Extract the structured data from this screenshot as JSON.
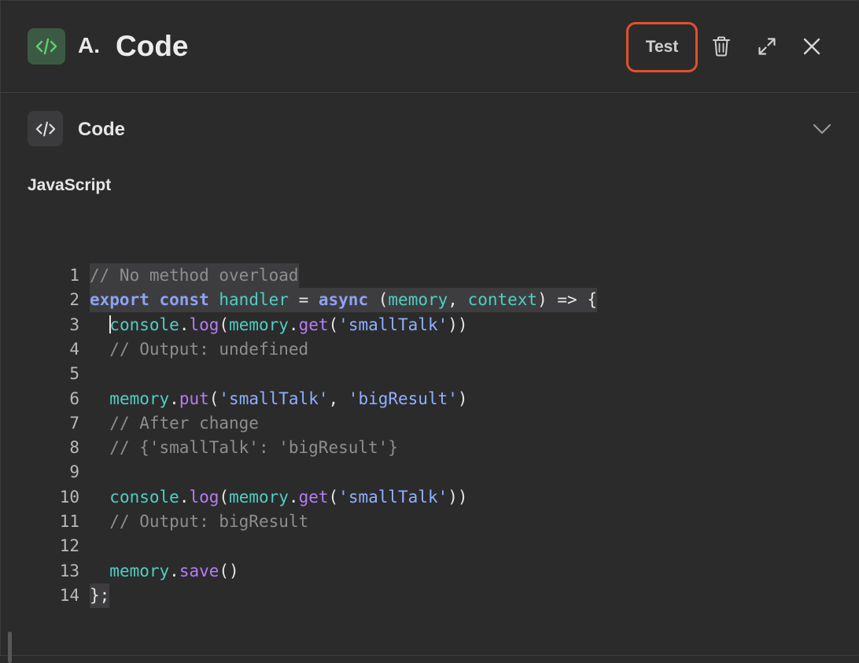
{
  "header": {
    "icon": "code-icon",
    "prefix": "A.",
    "title": "Code",
    "test_label": "Test",
    "buttons": [
      "trash-icon",
      "expand-icon",
      "close-icon"
    ],
    "accent_color": "#e2502b"
  },
  "section": {
    "icon": "code-icon",
    "title": "Code",
    "toggle_icon": "chevron-down-icon"
  },
  "editor": {
    "language_label": "JavaScript",
    "lines": [
      {
        "num": "1",
        "text": "// No method overload"
      },
      {
        "num": "2",
        "text": "export const handler = async (memory, context) => {"
      },
      {
        "num": "3",
        "text": "  console.log(memory.get('smallTalk'))"
      },
      {
        "num": "4",
        "text": "  // Output: undefined"
      },
      {
        "num": "5",
        "text": ""
      },
      {
        "num": "6",
        "text": "  memory.put('smallTalk', 'bigResult')"
      },
      {
        "num": "7",
        "text": "  // After change"
      },
      {
        "num": "8",
        "text": "  // {'smallTalk': 'bigResult'}"
      },
      {
        "num": "9",
        "text": ""
      },
      {
        "num": "10",
        "text": "  console.log(memory.get('smallTalk'))"
      },
      {
        "num": "11",
        "text": "  // Output: bigResult"
      },
      {
        "num": "12",
        "text": ""
      },
      {
        "num": "13",
        "text": "  memory.save()"
      },
      {
        "num": "14",
        "text": "};"
      }
    ]
  }
}
